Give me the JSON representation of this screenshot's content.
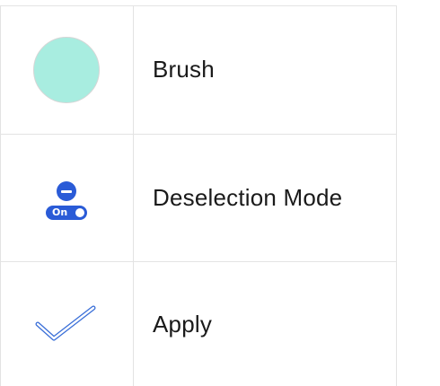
{
  "tools": [
    {
      "label": "Brush",
      "icon": "brush-color-swatch-icon",
      "swatch_color": "#a8ede0"
    },
    {
      "label": "Deselection Mode",
      "icon": "deselection-mode-icon",
      "toggle_text": "On",
      "accent_color": "#2a5bd7"
    },
    {
      "label": "Apply",
      "icon": "checkmark-icon",
      "accent_color": "#3a6fd8"
    }
  ]
}
